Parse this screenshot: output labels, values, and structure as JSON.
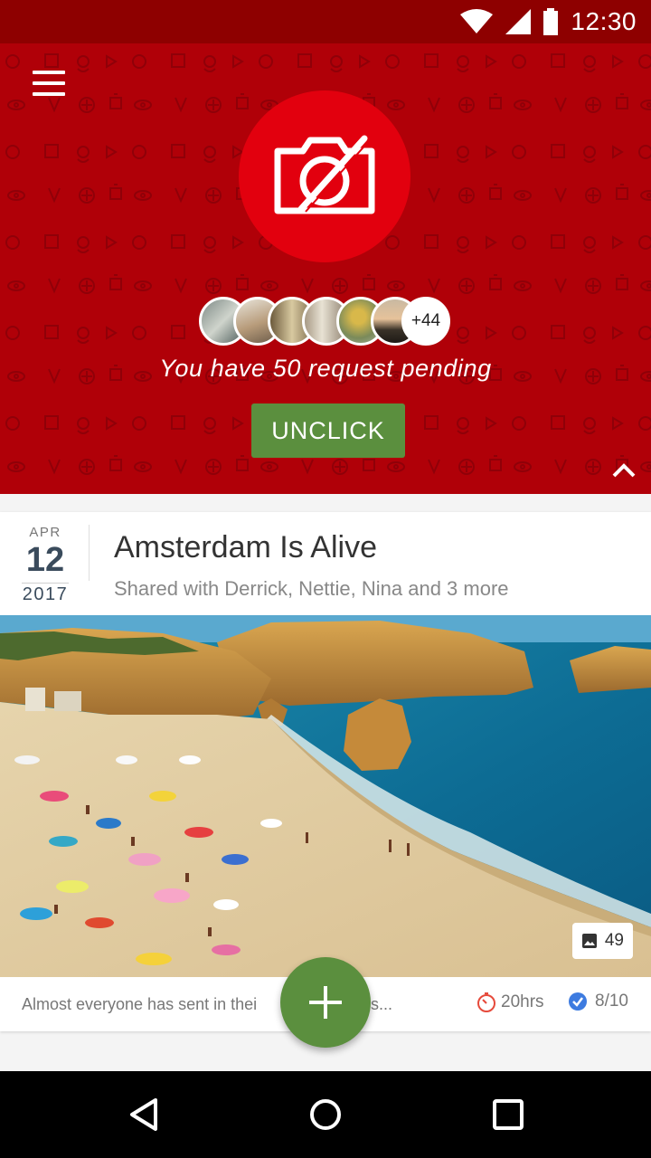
{
  "status_bar": {
    "time": "12:30"
  },
  "header": {
    "pending_text": "You have 50 request pending",
    "unclick_label": "UNCLICK",
    "avatars_more": "+44",
    "accent_color": "#b00008",
    "logo_color": "#e2000e"
  },
  "card": {
    "date": {
      "month": "APR",
      "day": "12",
      "year": "2017"
    },
    "title": "Amsterdam Is Alive",
    "subtitle": "Shared with Derrick, Nettie, Nina and 3 more",
    "photo_count": "49",
    "footer_text": "Almost everyone has sent in thei",
    "footer_text_tail": "s...",
    "timer": "20hrs",
    "progress": "8/10"
  },
  "fab_color": "#5b8f3e"
}
